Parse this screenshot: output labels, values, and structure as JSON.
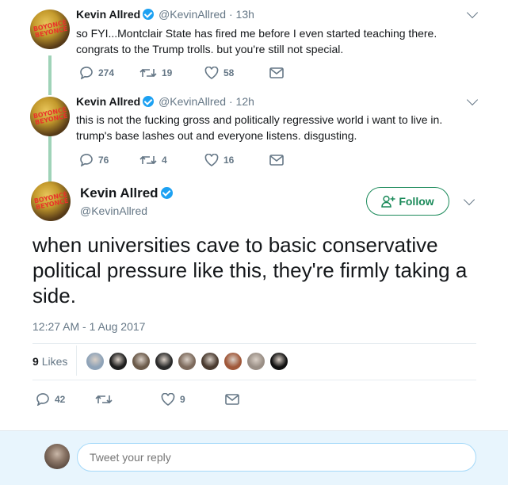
{
  "thread": [
    {
      "name": "Kevin Allred",
      "handle": "@KevinAllred",
      "time": "· 13h",
      "avatar_text": "BOYONCE / BEYONCE",
      "text_lines": [
        "so FYI...Montclair State has fired me before I even started teaching there.",
        "congrats to the Trump trolls. but you're still not special."
      ],
      "replies": "274",
      "retweets": "19",
      "likes": "58"
    },
    {
      "name": "Kevin Allred",
      "handle": "@KevinAllred",
      "time": "· 12h",
      "avatar_text": "BOYONCE / BEYONCE",
      "text_lines": [
        "this is not the fucking gross and politically regressive world i want to live in.",
        "trump's base lashes out and everyone listens. disgusting."
      ],
      "replies": "76",
      "retweets": "4",
      "likes": "16"
    }
  ],
  "main_tweet": {
    "name": "Kevin Allred",
    "handle": "@KevinAllred",
    "follow_label": "Follow",
    "text": "when universities cave to basic conservative political pressure like this, they're firmly taking a side.",
    "timestamp": "12:27 AM - 1 Aug 2017",
    "likes_count": "9",
    "likes_label": "Likes",
    "replies": "42",
    "retweets": "",
    "likes": "9"
  },
  "liker_colors": [
    "#8fa3b8",
    "#1e1e1e",
    "#6b5a4a",
    "#2b2b2b",
    "#7d6a5c",
    "#4a3b30",
    "#a0583a",
    "#9a8f86",
    "#111111"
  ],
  "reply_box": {
    "placeholder": "Tweet your reply"
  },
  "colors": {
    "follow_accent": "#1b8a5a",
    "verified": "#1da1f2",
    "thread_line": "#9fd3b8",
    "muted": "#657786"
  },
  "icons": [
    "reply-icon",
    "retweet-icon",
    "like-icon",
    "dm-icon",
    "chevron-down-icon",
    "verified-icon",
    "add-user-icon"
  ]
}
